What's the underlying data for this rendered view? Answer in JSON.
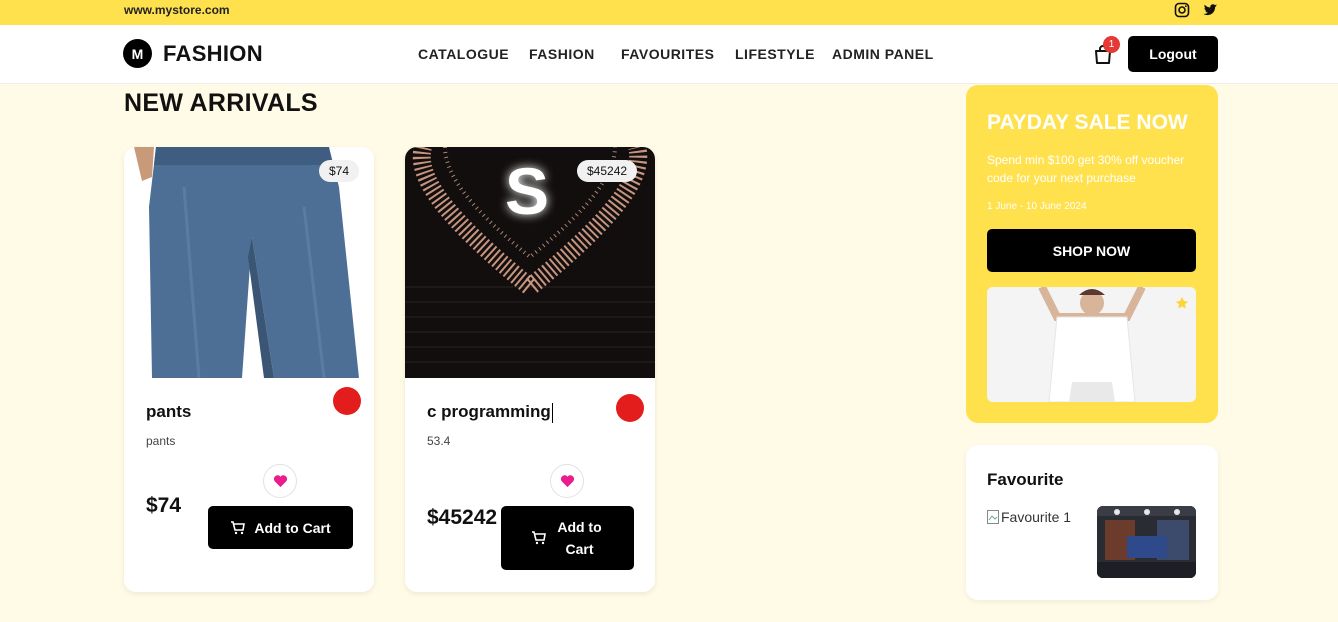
{
  "topbar": {
    "url": "www.mystore.com",
    "icons": [
      "instagram-icon",
      "twitter-icon"
    ]
  },
  "header": {
    "logo_letter": "M",
    "brand": "FASHION",
    "nav": [
      "CATALOGUE",
      "FASHION",
      "FAVOURITES",
      "LIFESTYLE",
      "ADMIN PANEL"
    ],
    "cart_count": "1",
    "logout_label": "Logout"
  },
  "main": {
    "section_title": "NEW ARRIVALS",
    "products": [
      {
        "price_tag": "$74",
        "name": "pants",
        "description": "pants",
        "price": "$74",
        "add_to_cart": "Add to Cart"
      },
      {
        "price_tag": "$45242",
        "name": "c programming",
        "description": "53.4",
        "price": "$45242",
        "add_to_cart": "Add to Cart",
        "image_letter": "S"
      }
    ]
  },
  "sale": {
    "title": "PAYDAY SALE NOW",
    "description": "Spend min $100 get 30% off voucher code for your next purchase",
    "date": "1 June - 10 June 2024",
    "button": "SHOP NOW"
  },
  "favourite": {
    "title": "Favourite",
    "image_alt": "Favourite 1"
  },
  "colors": {
    "accent": "#ffe14d",
    "background": "#fffbe6",
    "button": "#000000",
    "dot": "#e31c1c",
    "heart": "#e91e8c"
  }
}
